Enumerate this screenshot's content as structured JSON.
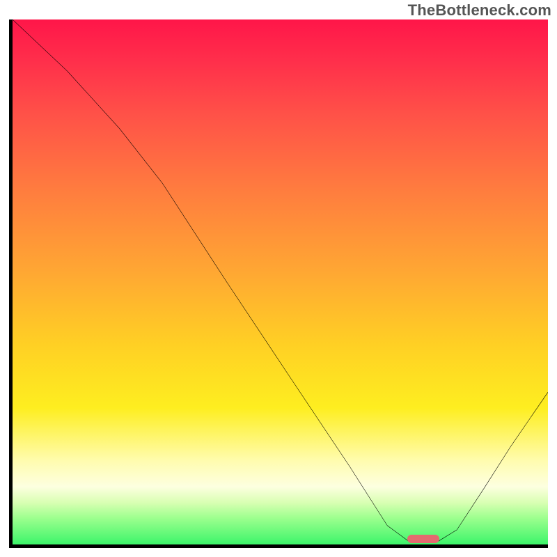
{
  "watermark": "TheBottleneck.com",
  "chart_data": {
    "type": "line",
    "title": "",
    "xlabel": "",
    "ylabel": "",
    "xlim": [
      0,
      100
    ],
    "ylim": [
      0,
      100
    ],
    "grid": false,
    "legend": false,
    "note": "Axes unlabelled; values expressed as percent of plot width/height. y=0 is bottom (green), y=100 is top (red).",
    "series": [
      {
        "name": "bottleneck-curve",
        "color": "#000000",
        "x": [
          0.0,
          10.2,
          20.0,
          28.0,
          40.0,
          52.0,
          63.0,
          70.0,
          74.0,
          79.5,
          83.0,
          88.0,
          93.0,
          100.0
        ],
        "y": [
          100.0,
          90.2,
          79.2,
          68.8,
          50.0,
          31.6,
          14.8,
          3.6,
          0.6,
          0.6,
          2.8,
          10.6,
          18.6,
          29.0
        ]
      }
    ],
    "marker": {
      "name": "optimal-range-pill",
      "color": "#e46a6f",
      "x_center": 76.7,
      "y_center": 1.0,
      "width_pct": 6.0,
      "height_pct": 1.6
    },
    "background_gradient_stops": [
      {
        "pct": 0,
        "color": "#ff1649"
      },
      {
        "pct": 8,
        "color": "#ff2f4b"
      },
      {
        "pct": 18,
        "color": "#ff5148"
      },
      {
        "pct": 32,
        "color": "#ff7b3f"
      },
      {
        "pct": 48,
        "color": "#ffa733"
      },
      {
        "pct": 62,
        "color": "#ffd024"
      },
      {
        "pct": 74,
        "color": "#feee20"
      },
      {
        "pct": 84,
        "color": "#fffcae"
      },
      {
        "pct": 89,
        "color": "#fdffe0"
      },
      {
        "pct": 92,
        "color": "#d9ffb3"
      },
      {
        "pct": 95,
        "color": "#9cff8e"
      },
      {
        "pct": 100,
        "color": "#3cf56a"
      }
    ]
  }
}
